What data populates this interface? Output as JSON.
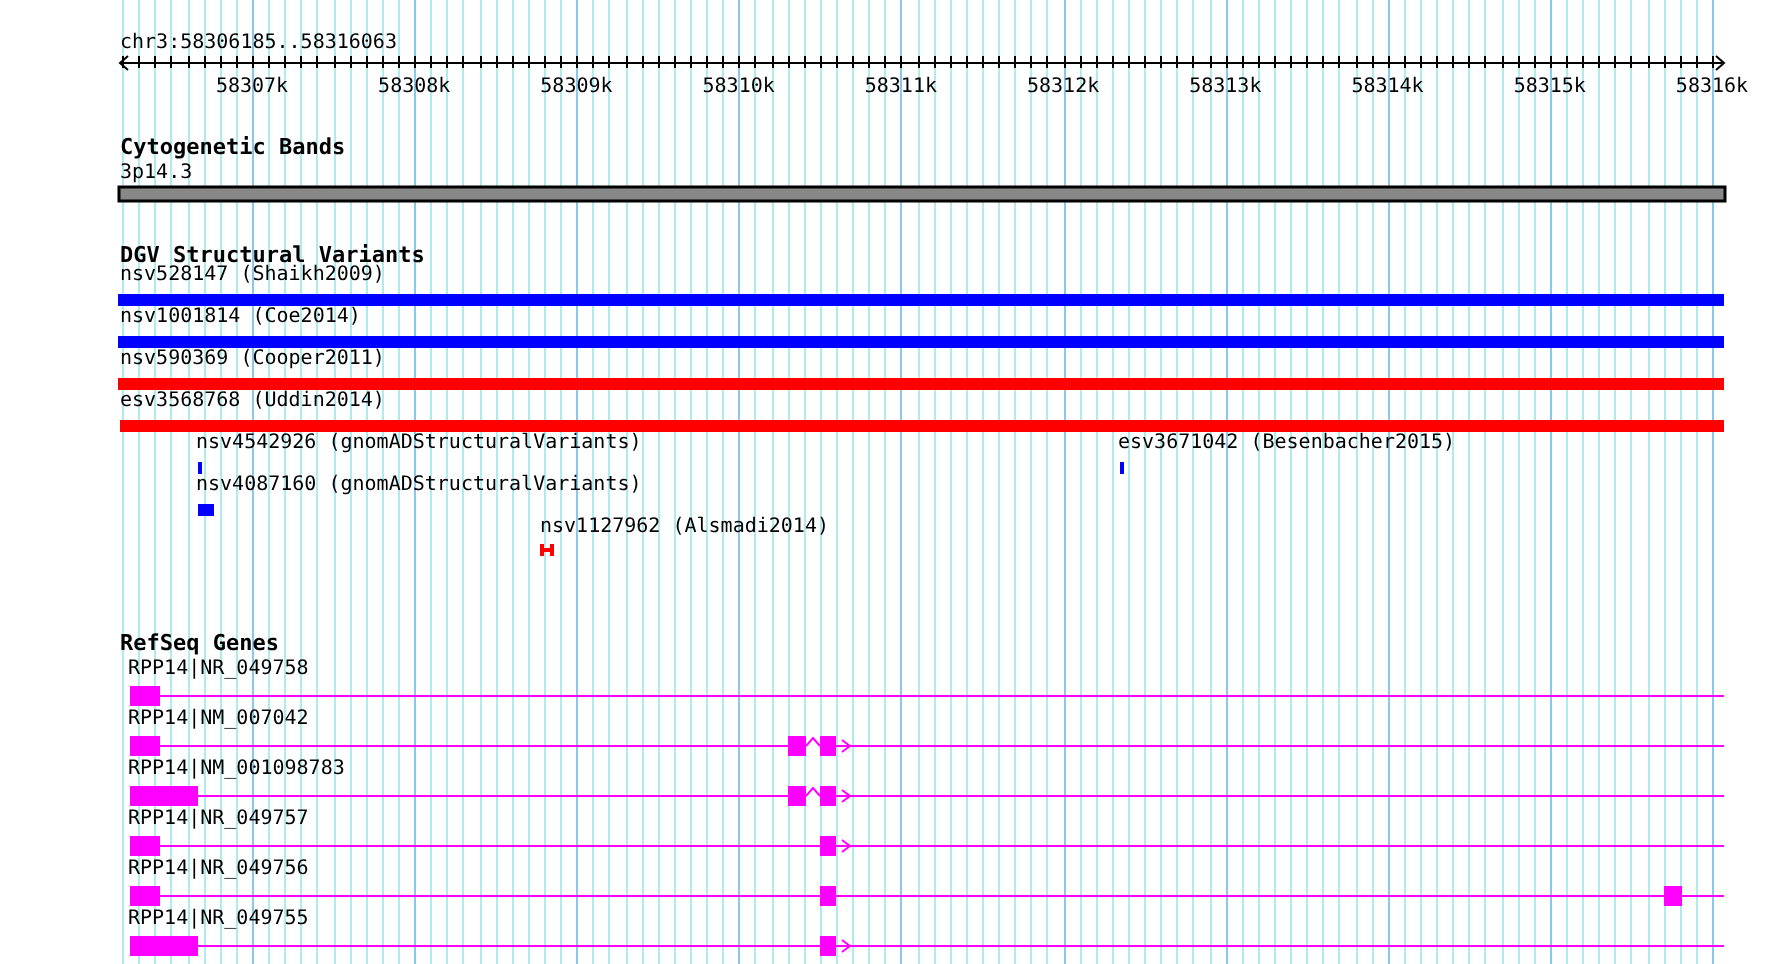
{
  "ruler": {
    "location": "chr3:58306185..58316063",
    "ticks": [
      "58307k",
      "58308k",
      "58309k",
      "58310k",
      "58311k",
      "58312k",
      "58313k",
      "58314k",
      "58315k",
      "58316k"
    ]
  },
  "tracks": [
    {
      "kind": "cytoband",
      "title": "Cytogenetic Bands",
      "features": [
        {
          "label": "3p14.3"
        }
      ]
    },
    {
      "kind": "variants",
      "title": "DGV Structural Variants",
      "features": [
        {
          "label": "nsv528147 (Shaikh2009)",
          "color": "#0000ff"
        },
        {
          "label": "nsv1001814 (Coe2014)",
          "color": "#0000ff"
        },
        {
          "label": "nsv590369 (Cooper2011)",
          "color": "#ff0000"
        },
        {
          "label": "esv3568768 (Uddin2014)",
          "color": "#ff0000"
        },
        {
          "label": "nsv4542926 (gnomADStructuralVariants)",
          "color": "#0000ff"
        },
        {
          "label": "esv3671042 (Besenbacher2015)",
          "color": "#0000ff"
        },
        {
          "label": "nsv4087160 (gnomADStructuralVariants)",
          "color": "#0000ff"
        },
        {
          "label": "nsv1127962 (Alsmadi2014)",
          "color": "#ff0000"
        }
      ]
    },
    {
      "kind": "genes",
      "title": "RefSeq Genes",
      "features": [
        {
          "label": "RPP14|NR_049758"
        },
        {
          "label": "RPP14|NM_007042"
        },
        {
          "label": "RPP14|NM_001098783"
        },
        {
          "label": "RPP14|NR_049757"
        },
        {
          "label": "RPP14|NR_049756"
        },
        {
          "label": "RPP14|NR_049755"
        }
      ]
    }
  ]
}
